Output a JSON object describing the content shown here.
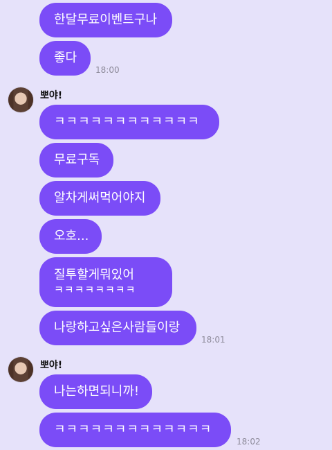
{
  "messages": [
    {
      "text": "한달무료이벤트구나"
    },
    {
      "text": "좋다",
      "time": "18:00"
    },
    {
      "sender": "뽀야!",
      "text": "ㅋㅋㅋㅋㅋㅋㅋㅋㅋㅋㅋㅋ"
    },
    {
      "text": "무료구독"
    },
    {
      "text": "알차게써먹어야지"
    },
    {
      "text": "오호..."
    },
    {
      "text": "질투할게뭐있어",
      "text2": "ㅋㅋㅋㅋㅋㅋㅋㅋ"
    },
    {
      "text": "나랑하고싶은사람들이랑",
      "time": "18:01"
    },
    {
      "sender": "뽀야!",
      "text": "나는하면되니까!"
    },
    {
      "text": "ㅋㅋㅋㅋㅋㅋㅋㅋㅋㅋㅋㅋㅋ",
      "time": "18:02"
    }
  ],
  "colors": {
    "background": "#e6e2fa",
    "bubble": "#7b4cf7",
    "bubble_text": "#ffffff",
    "timestamp": "#8d8a99"
  }
}
